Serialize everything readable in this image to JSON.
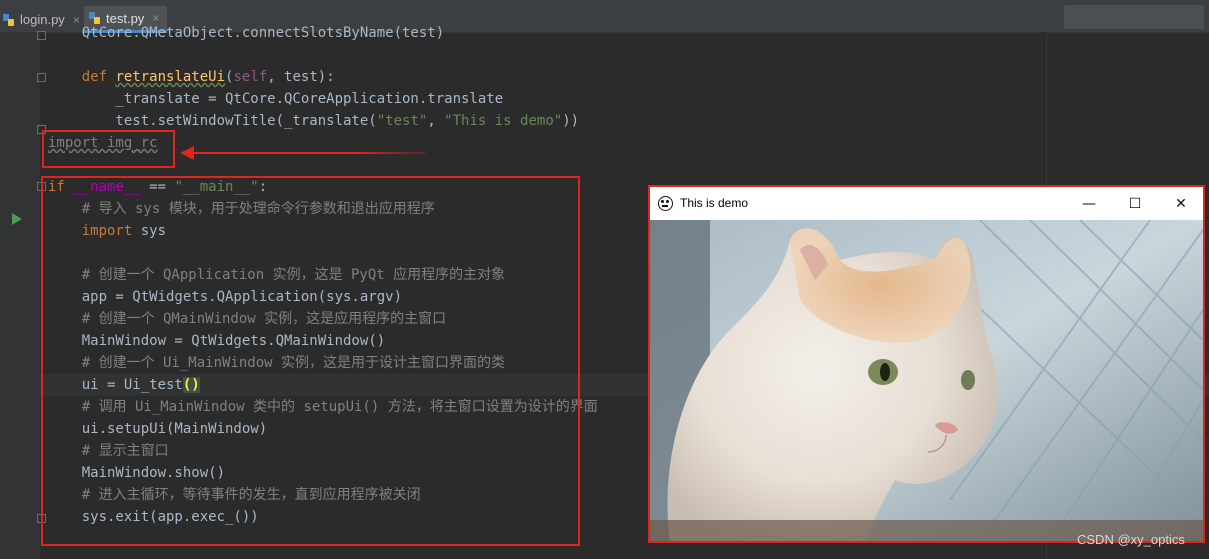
{
  "tabs": [
    {
      "label": "login.py",
      "close": "×"
    },
    {
      "label": "test.py",
      "close": "×"
    }
  ],
  "code": {
    "line_top": "    QtCore.QMetaObject.connectSlotsByName(test)",
    "def_kw": "def",
    "def_name": "retranslateUi",
    "def_self": "self",
    "def_rest": ", test):",
    "translate_line": "        _translate = QtCore.QCoreApplication.translate",
    "title_line_a": "        test.setWindowTitle(_translate(",
    "title_str1": "\"test\"",
    "title_sep": ", ",
    "title_str2": "\"This is demo\"",
    "title_end": "))",
    "import_img": "import img_rc",
    "if_kw": "if",
    "if_name": "__name__",
    "if_op": " == ",
    "if_str": "\"__main__\"",
    "if_colon": ":",
    "c1": "    # 导入 sys 模块，用于处理命令行参数和退出应用程序",
    "import_kw": "    import",
    "import_sys": " sys",
    "c2": "    # 创建一个 QApplication 实例，这是 PyQt 应用程序的主对象",
    "app_line": "    app = QtWidgets.QApplication(sys.argv)",
    "c3": "    # 创建一个 QMainWindow 实例，这是应用程序的主窗口",
    "mw_line": "    MainWindow = QtWidgets.QMainWindow()",
    "c4": "    # 创建一个 Ui_MainWindow 实例，这是用于设计主窗口界面的类",
    "ui_line": "    ui = Ui_test",
    "ui_paren": "()",
    "c5": "    # 调用 Ui_MainWindow 类中的 setupUi() 方法，将主窗口设置为设计的界面",
    "setup_line": "    ui.setupUi(MainWindow)",
    "c6": "    # 显示主窗口",
    "show_line": "    MainWindow.show()",
    "c7": "    # 进入主循环，等待事件的发生，直到应用程序被关闭",
    "exit_line": "    sys.exit(app.exec_())"
  },
  "demo_window": {
    "title": "This is demo",
    "minimize": "—",
    "maximize": "☐",
    "close": "✕",
    "image": "white-and-orange-kitten-photo"
  },
  "watermark": "CSDN @xy_optics",
  "colors": {
    "annotation": "#e0251c",
    "editor_bg": "#2b2b2b"
  }
}
